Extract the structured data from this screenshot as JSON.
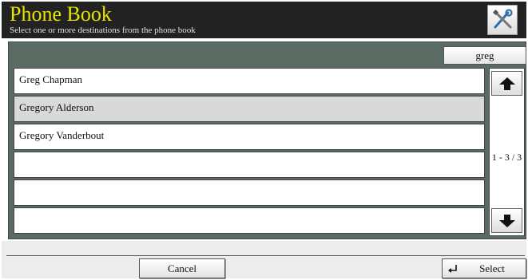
{
  "header": {
    "title": "Phone Book",
    "subtitle": "Select one or more destinations from the phone book",
    "tools_icon": "wrench-screwdriver-icon"
  },
  "search": {
    "label": "greg"
  },
  "entries": [
    {
      "name": "Greg Chapman",
      "selected": false
    },
    {
      "name": "Gregory Alderson",
      "selected": true
    },
    {
      "name": "Gregory Vanderbout",
      "selected": false
    },
    {
      "name": "",
      "selected": false
    },
    {
      "name": "",
      "selected": false
    },
    {
      "name": "",
      "selected": false
    }
  ],
  "pagination": {
    "text": "1 - 3 / 3",
    "up_icon": "arrow-up-icon",
    "down_icon": "arrow-down-icon"
  },
  "footer": {
    "cancel_label": "Cancel",
    "select_label": "Select",
    "select_icon": "enter-icon"
  },
  "colors": {
    "header_bg": "#222222",
    "title": "#e6e600",
    "panel_bg": "#5a6b63",
    "selected_row": "#d9d9d9"
  }
}
